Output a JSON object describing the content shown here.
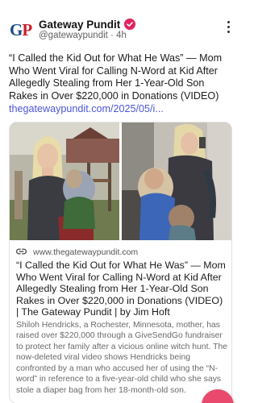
{
  "post": {
    "author_name": "Gateway Pundit",
    "handle": "@gatewaypundit",
    "separator": "·",
    "time": "4h",
    "avatar_text": {
      "g": "G",
      "p": "P"
    },
    "text": "“I Called the Kid Out for What He Was” — Mom Who Went Viral for Calling N-Word at Kid After Allegedly Stealing from Her 1-Year-Old Son Rakes in Over $220,000 in Donations (VIDEO)",
    "link_text": "thegatewaypundit.com/2025/05/i..."
  },
  "card": {
    "domain": "www.thegatewaypundit.com",
    "title": "“I Called the Kid Out for What He Was” — Mom Who Went Viral for Calling N-Word at Kid After Allegedly Stealing from Her 1-Year-Old Son Rakes in Over $220,000 in Donations (VIDEO) | The Gateway Pundit | by Jim Hoft",
    "description": "Shiloh Hendricks, a Rochester, Minnesota, mother, has raised over $220,000 through a GiveSendGo fundraiser to protect her family after a vicious online witch hunt. The now-deleted viral video shows Hendricks being confronted by a man who accused her of using the “N-word” in reference to a five-year-old child who she says stole a diaper bag from her 18-month-old son."
  },
  "colors": {
    "link": "#4a57d6",
    "verified": "#e0245e",
    "fab": "#e8496c"
  },
  "icons": {
    "verified": "verified-badge-icon",
    "more": "more-vertical-icon",
    "link": "link-icon",
    "fab": "compose-fab-icon"
  }
}
